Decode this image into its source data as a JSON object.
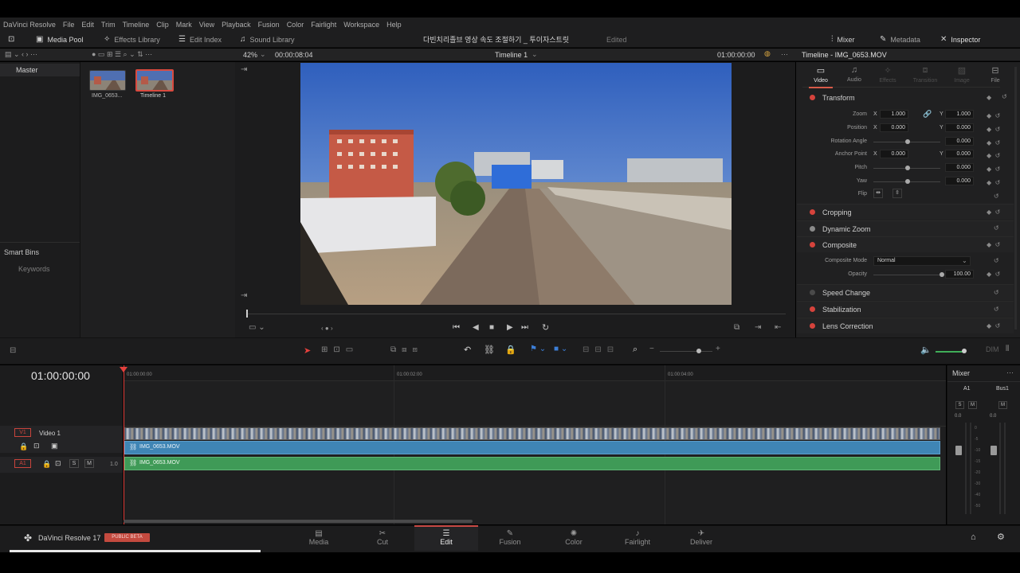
{
  "menu": [
    "DaVinci Resolve",
    "File",
    "Edit",
    "Trim",
    "Timeline",
    "Clip",
    "Mark",
    "View",
    "Playback",
    "Fusion",
    "Color",
    "Fairlight",
    "Workspace",
    "Help"
  ],
  "toolbar": {
    "media_pool": "Media Pool",
    "effects_library": "Effects Library",
    "edit_index": "Edit Index",
    "sound_library": "Sound Library",
    "project_title": "다빈치리졸브 영상 속도 조절하기 _ 투이자스트릿",
    "edited": "Edited",
    "mixer": "Mixer",
    "metadata": "Metadata",
    "inspector": "Inspector"
  },
  "viewer": {
    "zoom": "42%",
    "duration": "00:00:08:04",
    "timeline_name": "Timeline 1",
    "timecode": "01:00:00:00"
  },
  "media_pool": {
    "master": "Master",
    "smart_bins": "Smart Bins",
    "keywords": "Keywords",
    "clips": [
      {
        "label": "IMG_0653..."
      },
      {
        "label": "Timeline 1"
      }
    ]
  },
  "inspector": {
    "title": "Timeline - IMG_0653.MOV",
    "tabs": [
      "Video",
      "Audio",
      "Effects",
      "Transition",
      "Image",
      "File"
    ],
    "transform": "Transform",
    "zoom_label": "Zoom",
    "zoom_x": "1.000",
    "zoom_y": "1.000",
    "position_label": "Position",
    "position_x": "0.000",
    "position_y": "0.000",
    "rotation_label": "Rotation Angle",
    "rotation": "0.000",
    "anchor_label": "Anchor Point",
    "anchor_x": "0.000",
    "anchor_y": "0.000",
    "pitch_label": "Pitch",
    "pitch": "0.000",
    "yaw_label": "Yaw",
    "yaw": "0.000",
    "flip_label": "Flip",
    "x": "X",
    "y": "Y",
    "cropping": "Cropping",
    "dynamic_zoom": "Dynamic Zoom",
    "composite": "Composite",
    "composite_mode_label": "Composite Mode",
    "composite_mode": "Normal",
    "opacity_label": "Opacity",
    "opacity": "100.00",
    "speed_change": "Speed Change",
    "stabilization": "Stabilization",
    "lens_correction": "Lens Correction"
  },
  "timeline": {
    "timecode": "01:00:00:00",
    "ruler": [
      "01:00:00:00",
      "01:00:02:00",
      "01:00:04:00"
    ],
    "v1": "V1",
    "video_track": "Video 1",
    "a1": "A1",
    "audio_level": "1.0",
    "s": "S",
    "m": "M",
    "video_clip": "IMG_0653.MOV",
    "audio_clip": "IMG_0653.MOV"
  },
  "mixer": {
    "title": "Mixer",
    "a1": "A1",
    "bus1": "Bus1",
    "s": "S",
    "m": "M",
    "level_a1": "0.0",
    "level_bus": "0.0",
    "scale": [
      "0",
      "-5",
      "-10",
      "-15",
      "-20",
      "-30",
      "-40",
      "-50"
    ]
  },
  "bottom": {
    "app_name": "DaVinci Resolve 17",
    "badge": "PUBLIC BETA",
    "pages": [
      "Media",
      "Cut",
      "Edit",
      "Fusion",
      "Color",
      "Fairlight",
      "Deliver"
    ]
  },
  "colors": {
    "accent_red": "#e5413d",
    "clip_blue": "#3f85b5",
    "clip_green": "#3f9a57",
    "edit_active": "#c94a45"
  }
}
